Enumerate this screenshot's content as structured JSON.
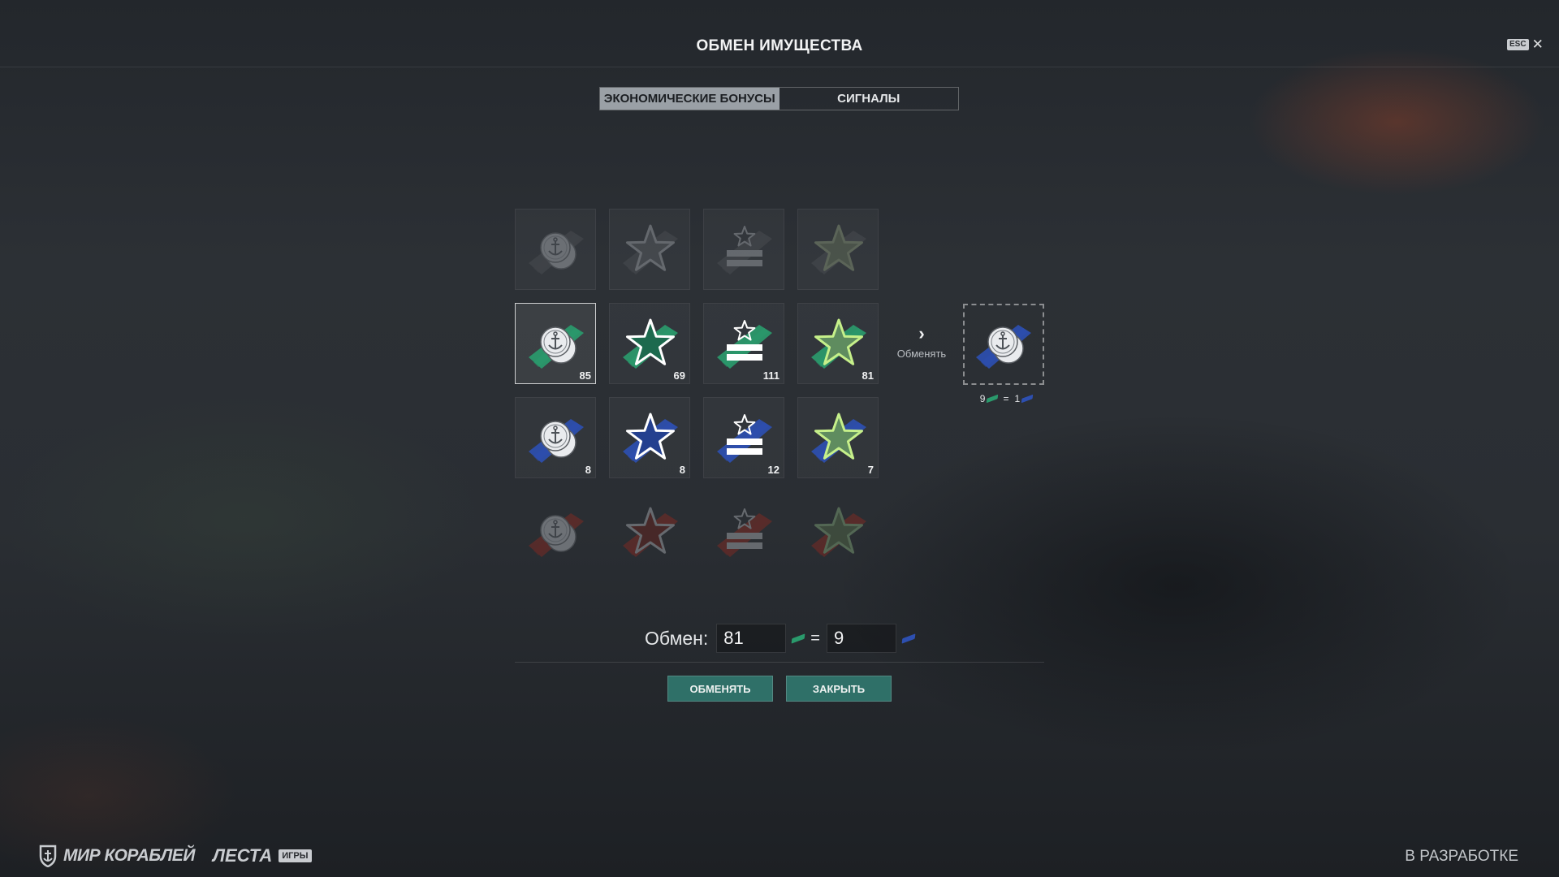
{
  "header": {
    "title": "ОБМЕН ИМУЩЕСТВА",
    "esc_label": "ESC",
    "close_glyph": "✕"
  },
  "tabs": [
    {
      "label": "ЭКОНОМИЧЕСКИЕ БОНУСЫ",
      "active": true
    },
    {
      "label": "СИГНАЛЫ",
      "active": false
    }
  ],
  "grid": {
    "rows": [
      {
        "tier": "grey",
        "items": [
          {
            "icon": "credits-anchor-icon",
            "count": ""
          },
          {
            "icon": "star-icon",
            "count": ""
          },
          {
            "icon": "commander-xp-star-icon",
            "count": ""
          },
          {
            "icon": "green-star-icon",
            "count": ""
          }
        ]
      },
      {
        "tier": "green",
        "items": [
          {
            "icon": "credits-anchor-icon",
            "count": "85"
          },
          {
            "icon": "star-icon",
            "count": "69"
          },
          {
            "icon": "commander-xp-star-icon",
            "count": "111"
          },
          {
            "icon": "green-star-icon",
            "count": "81"
          }
        ]
      },
      {
        "tier": "blue",
        "items": [
          {
            "icon": "credits-anchor-icon",
            "count": "8"
          },
          {
            "icon": "star-icon",
            "count": "8"
          },
          {
            "icon": "commander-xp-star-icon",
            "count": "12"
          },
          {
            "icon": "green-star-icon",
            "count": "7"
          }
        ]
      },
      {
        "tier": "red",
        "items": [
          {
            "icon": "credits-anchor-icon",
            "count": ""
          },
          {
            "icon": "star-icon",
            "count": ""
          },
          {
            "icon": "commander-xp-star-icon",
            "count": ""
          },
          {
            "icon": "green-star-icon",
            "count": ""
          }
        ]
      }
    ]
  },
  "exchange_arrow": {
    "glyph": "›",
    "label": "Обменять"
  },
  "target": {
    "icon": "credits-anchor-icon",
    "rate_from": "9",
    "rate_eq": "=",
    "rate_to": "1"
  },
  "exchange": {
    "label": "Обмен:",
    "from_value": "81",
    "equals": "=",
    "to_value": "9"
  },
  "buttons": {
    "exchange": "ОБМЕНЯТЬ",
    "close": "ЗАКРЫТЬ"
  },
  "footer": {
    "logo1": "МИР КОРАБЛЕЙ",
    "logo2": "ЛЕСТА",
    "logo2_badge": "ИГРЫ",
    "status": "В РАЗРАБОТКЕ"
  },
  "colors": {
    "green": "#2a9a6c",
    "blue": "#2d4fb0",
    "red": "#7a2a24",
    "grey": "#6b6f74",
    "button": "#2f7068"
  }
}
